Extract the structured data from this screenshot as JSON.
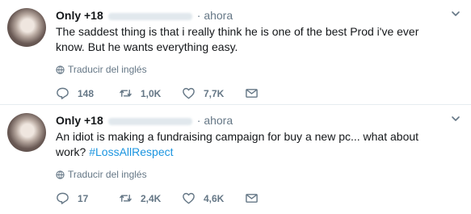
{
  "tweets": [
    {
      "name": "Only +18",
      "time": "· ahora",
      "text": "The saddest thing is that i really think he is one of the best Prod i've ever know. But he wants everything easy.",
      "hashtag": "",
      "translate_label": "Traducir del inglés",
      "replies": "148",
      "retweets": "1,0K",
      "likes": "7,7K"
    },
    {
      "name": "Only +18",
      "time": "· ahora",
      "text": "An idiot is making a fundraising campaign for buy a new pc... what about work? ",
      "hashtag": "#LossAllRespect",
      "translate_label": "Traducir del inglés",
      "replies": "17",
      "retweets": "2,4K",
      "likes": "4,6K"
    }
  ],
  "icons": {
    "reply": "reply-icon",
    "retweet": "retweet-icon",
    "like": "heart-icon",
    "message": "envelope-icon",
    "translate": "globe-icon",
    "menu": "chevron-down-icon"
  },
  "colors": {
    "text": "#14171a",
    "muted": "#657786",
    "link": "#1b95e0",
    "divider": "#e6ecf0"
  }
}
